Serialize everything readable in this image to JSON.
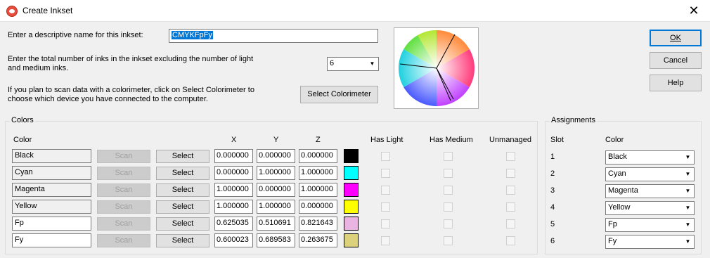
{
  "window": {
    "title": "Create Inkset",
    "close_glyph": "✕"
  },
  "form": {
    "name_label": "Enter a descriptive name for this inkset:",
    "name_value": "CMYKFpFy",
    "ink_count_label": "Enter the total number of inks in the inkset excluding the number of light and medium inks.",
    "ink_count_value": "6",
    "colorimeter_label": "If you plan to scan data with a colorimeter, click on Select Colorimeter to choose which device you have connected to the computer.",
    "select_colorimeter": "Select Colorimeter"
  },
  "buttons": {
    "ok": "OK",
    "cancel": "Cancel",
    "help": "Help"
  },
  "colors_group": {
    "title": "Colors",
    "headers": {
      "color": "Color",
      "x": "X",
      "y": "Y",
      "z": "Z",
      "has_light": "Has Light",
      "has_medium": "Has Medium",
      "unmanaged": "Unmanaged"
    },
    "scan_label": "Scan",
    "select_label": "Select",
    "rows": [
      {
        "name": "Black",
        "x": "0.000000",
        "y": "0.000000",
        "z": "0.000000",
        "swatch": "#000000",
        "editable": false
      },
      {
        "name": "Cyan",
        "x": "0.000000",
        "y": "1.000000",
        "z": "1.000000",
        "swatch": "#00ffff",
        "editable": false
      },
      {
        "name": "Magenta",
        "x": "1.000000",
        "y": "0.000000",
        "z": "1.000000",
        "swatch": "#ff00ff",
        "editable": false
      },
      {
        "name": "Yellow",
        "x": "1.000000",
        "y": "1.000000",
        "z": "0.000000",
        "swatch": "#ffff00",
        "editable": false
      },
      {
        "name": "Fp",
        "x": "0.625035",
        "y": "0.510691",
        "z": "0.821643",
        "swatch": "#e9b3e2",
        "editable": true
      },
      {
        "name": "Fy",
        "x": "0.600023",
        "y": "0.689583",
        "z": "0.263675",
        "swatch": "#dcd27c",
        "editable": true
      }
    ]
  },
  "assignments_group": {
    "title": "Assignments",
    "headers": {
      "slot": "Slot",
      "color": "Color"
    },
    "rows": [
      {
        "slot": "1",
        "color": "Black"
      },
      {
        "slot": "2",
        "color": "Cyan"
      },
      {
        "slot": "3",
        "color": "Magenta"
      },
      {
        "slot": "4",
        "color": "Yellow"
      },
      {
        "slot": "5",
        "color": "Fp"
      },
      {
        "slot": "6",
        "color": "Fy"
      }
    ]
  },
  "icons": {
    "app": "app-logo-icon",
    "close": "close-icon",
    "dropdown": "chevron-down-icon",
    "wheel": "color-wheel-icon"
  }
}
